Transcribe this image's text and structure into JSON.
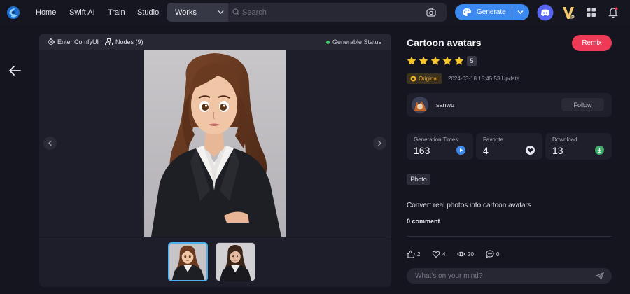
{
  "nav": {
    "items": [
      "Home",
      "Swift AI",
      "Train",
      "Studio"
    ],
    "works_select": "Works",
    "search_placeholder": "Search",
    "generate_label": "Generate"
  },
  "panel": {
    "enter_label": "Enter ComfyUI",
    "nodes_label": "Nodes (9)",
    "status_label": "Generable Status"
  },
  "detail": {
    "title": "Cartoon avatars",
    "remix_label": "Remix",
    "rating": 5,
    "rating_label": "5",
    "badge_label": "Original",
    "date": "2024-03-18 15:45:53 Update",
    "author": "sanwu",
    "follow_label": "Follow",
    "stats": [
      {
        "label": "Generation Times",
        "value": "163"
      },
      {
        "label": "Favorite",
        "value": "4"
      },
      {
        "label": "Download",
        "value": "13"
      }
    ],
    "tag": "Photo",
    "description": "Convert real photos into cartoon avatars",
    "comment_count": "0 comment",
    "actions": {
      "likes": "2",
      "favorites": "4",
      "views": "20",
      "comments": "0"
    },
    "comment_placeholder": "What's on your mind?"
  },
  "colors": {
    "accent_blue": "#3c89f0",
    "remix_red": "#ee3a57",
    "star_yellow": "#f7c52b",
    "status_green": "#3fcf6a",
    "badge_gold": "#f5b12f"
  },
  "icons": [
    "logo-icon",
    "chevron-down-icon",
    "search-icon",
    "camera-icon",
    "palette-icon",
    "discord-icon",
    "vip-icon",
    "apps-icon",
    "bell-icon",
    "back-arrow-icon",
    "comfyui-icon",
    "nodes-icon",
    "star-icon",
    "original-icon",
    "play-icon",
    "heart-icon",
    "download-icon",
    "thumbs-up-icon",
    "eye-icon",
    "comment-icon",
    "send-icon"
  ]
}
